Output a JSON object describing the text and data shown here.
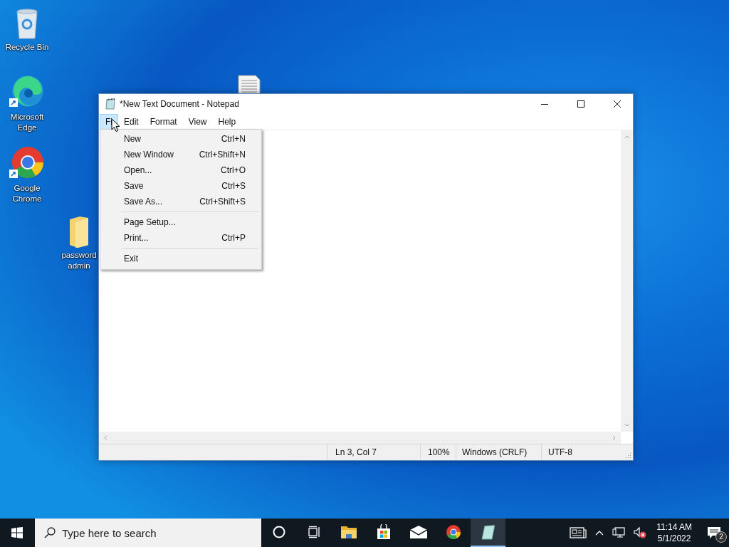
{
  "desktop_icons": [
    {
      "kind": "recycle",
      "label": "Recycle Bin"
    },
    {
      "kind": "edge",
      "label": "Microsoft Edge"
    },
    {
      "kind": "chrome",
      "label": "Google Chrome"
    },
    {
      "kind": "folder",
      "label": "password admin"
    },
    {
      "kind": "document"
    }
  ],
  "window": {
    "title": "*New Text Document - Notepad",
    "menu": [
      {
        "label": "Fi",
        "selected": true
      },
      {
        "label": "Edit",
        "selected": false
      },
      {
        "label": "Format",
        "selected": false
      },
      {
        "label": "View",
        "selected": false
      },
      {
        "label": "Help",
        "selected": false
      }
    ],
    "file_menu": [
      {
        "kind": "item",
        "label": "New",
        "shortcut": "Ctrl+N"
      },
      {
        "kind": "item",
        "label": "New Window",
        "shortcut": "Ctrl+Shift+N"
      },
      {
        "kind": "item",
        "label": "Open...",
        "shortcut": "Ctrl+O"
      },
      {
        "kind": "item",
        "label": "Save",
        "shortcut": "Ctrl+S"
      },
      {
        "kind": "item",
        "label": "Save As...",
        "shortcut": "Ctrl+Shift+S"
      },
      {
        "kind": "separator"
      },
      {
        "kind": "item",
        "label": "Page Setup..."
      },
      {
        "kind": "item",
        "label": "Print...",
        "shortcut": "Ctrl+P"
      },
      {
        "kind": "separator"
      },
      {
        "kind": "item",
        "label": "Exit"
      }
    ],
    "status_bar": [
      "Ln 3, Col 7",
      "100%",
      "Windows (CRLF)",
      "UTF-8"
    ]
  },
  "taskbar": {
    "search": {
      "placeholder": "Type here to search"
    },
    "apps": [
      {
        "kind": "cortana",
        "selected": false
      },
      {
        "kind": "taskview",
        "selected": false
      },
      {
        "kind": "explorer",
        "selected": false
      },
      {
        "kind": "store",
        "selected": false
      },
      {
        "kind": "mail",
        "selected": false
      },
      {
        "kind": "chrome",
        "selected": false
      },
      {
        "kind": "notepad",
        "selected": true
      }
    ],
    "time": "11:14 AM",
    "date": "5/1/2022",
    "notifications": "2"
  }
}
